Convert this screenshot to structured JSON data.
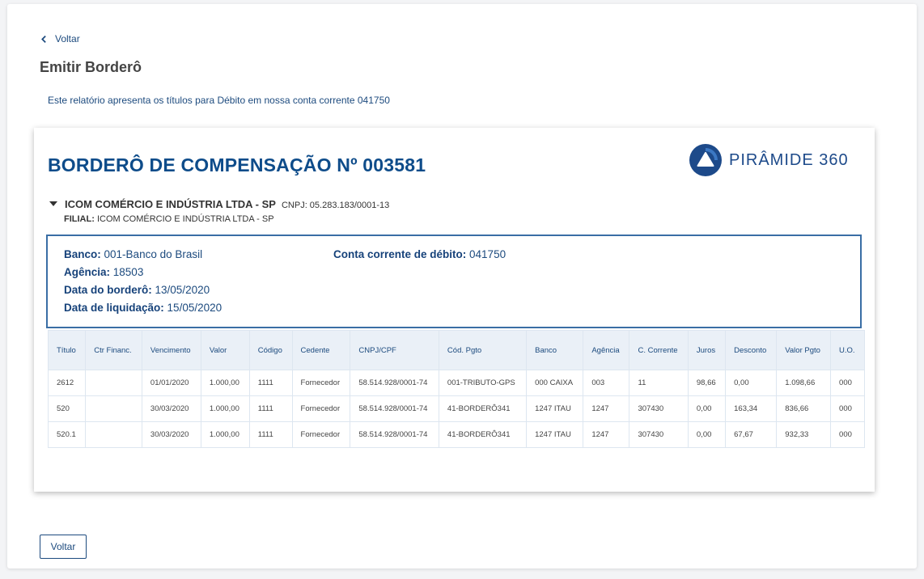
{
  "nav": {
    "back_label": "Voltar"
  },
  "page": {
    "title": "Emitir Borderô",
    "description": "Este relatório apresenta os títulos para Débito em nossa conta corrente 041750"
  },
  "report": {
    "title": "BORDERÔ DE COMPENSAÇÃO Nº 003581",
    "logo_text": "PIRÂMIDE 360",
    "company_name": "ICOM COMÉRCIO E INDÚSTRIA LTDA - SP",
    "cnpj": "CNPJ: 05.283.183/0001-13",
    "filial_label": "FILIAL:",
    "filial_value": "ICOM COMÉRCIO E INDÚSTRIA LTDA - SP"
  },
  "info": {
    "banco_label": "Banco:",
    "banco_value": "001-Banco do Brasil",
    "agencia_label": "Agência:",
    "agencia_value": "18503",
    "data_bordero_label": "Data do borderô:",
    "data_bordero_value": "13/05/2020",
    "data_liquidacao_label": "Data de liquidação:",
    "data_liquidacao_value": "15/05/2020",
    "conta_label": "Conta corrente de débito:",
    "conta_value": "041750"
  },
  "table": {
    "headers": [
      "Título",
      "Ctr Financ.",
      "Vencimento",
      "Valor",
      "Código",
      "Cedente",
      "CNPJ/CPF",
      "Cód. Pgto",
      "Banco",
      "Agência",
      "C. Corrente",
      "Juros",
      "Desconto",
      "Valor Pgto",
      "U.O."
    ],
    "rows": [
      [
        "2612",
        "",
        "01/01/2020",
        "1.000,00",
        "1111",
        "Fornecedor",
        "58.514.928/0001-74",
        "001-TRIBUTO-GPS",
        "000 CAIXA",
        "003",
        "11",
        "98,66",
        "0,00",
        "1.098,66",
        "000"
      ],
      [
        "520",
        "",
        "30/03/2020",
        "1.000,00",
        "1111",
        "Fornecedor",
        "58.514.928/0001-74",
        "41-BORDERÔ341",
        "1247 ITAU",
        "1247",
        "307430",
        "0,00",
        "163,34",
        "836,66",
        "000"
      ],
      [
        "520.1",
        "",
        "30/03/2020",
        "1.000,00",
        "1111",
        "Fornecedor",
        "58.514.928/0001-74",
        "41-BORDERÔ341",
        "1247 ITAU",
        "1247",
        "307430",
        "0,00",
        "67,67",
        "932,33",
        "000"
      ]
    ]
  },
  "footer": {
    "back_button_label": "Voltar"
  },
  "colors": {
    "primary": "#1c4a7e",
    "title_blue": "#0e4c8a",
    "table_header_bg": "#eaf0f7"
  },
  "icons": {
    "back": "chevron-left-icon",
    "expand": "caret-down-icon",
    "logo": "piramide-logo-icon"
  }
}
